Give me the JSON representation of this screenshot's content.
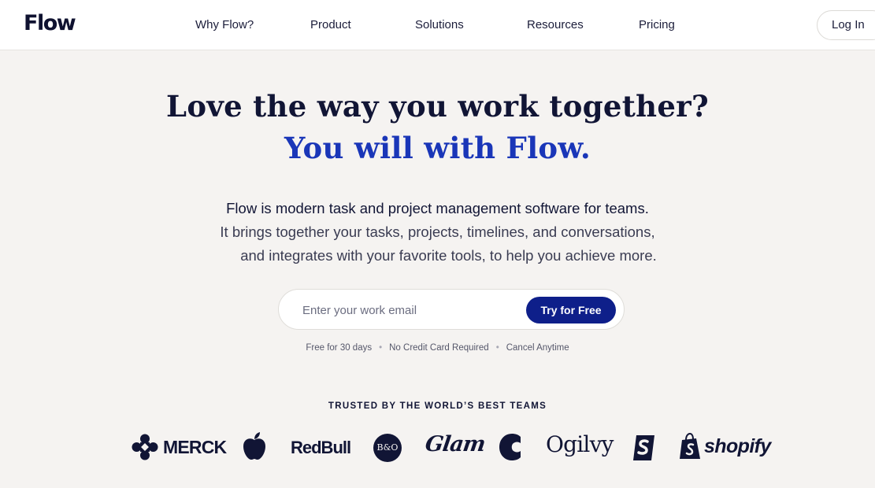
{
  "nav": {
    "logo": "Flow",
    "items": [
      "Why Flow?",
      "Product",
      "Solutions",
      "Resources",
      "Pricing"
    ],
    "login": "Log In"
  },
  "hero": {
    "headline": "Love the way you work together?",
    "subheadline": "You will with Flow.",
    "desc1": "Flow is modern task and project management software for teams.",
    "desc2": "It brings together your tasks, projects, timelines, and conversations,",
    "desc3": "and integrates with your favorite tools, to help you achieve more.",
    "email_placeholder": "Enter your work email",
    "cta": "Try for Free",
    "perks": [
      "Free for 30 days",
      "No Credit Card Required",
      "Cancel Anytime"
    ]
  },
  "trusted": {
    "title": "TRUSTED BY THE WORLD’S BEST TEAMS",
    "logos": [
      "merck-logo",
      "apple-logo",
      "redbull-logo",
      "bang-olufsen-logo",
      "glam-logo",
      "carhartt-logo",
      "ogilvy-logo",
      "shopify-s-logo",
      "shopify-logo"
    ],
    "merck": "MERCK",
    "redbull": "RedBull",
    "bo": "B&O",
    "glam": "Glam",
    "ogilvy": "Ogilvy",
    "shopify": "shopify"
  },
  "colors": {
    "accent": "#1a36b8",
    "button": "#0e1f8a",
    "background": "#f5f3f1",
    "text": "#111535"
  }
}
